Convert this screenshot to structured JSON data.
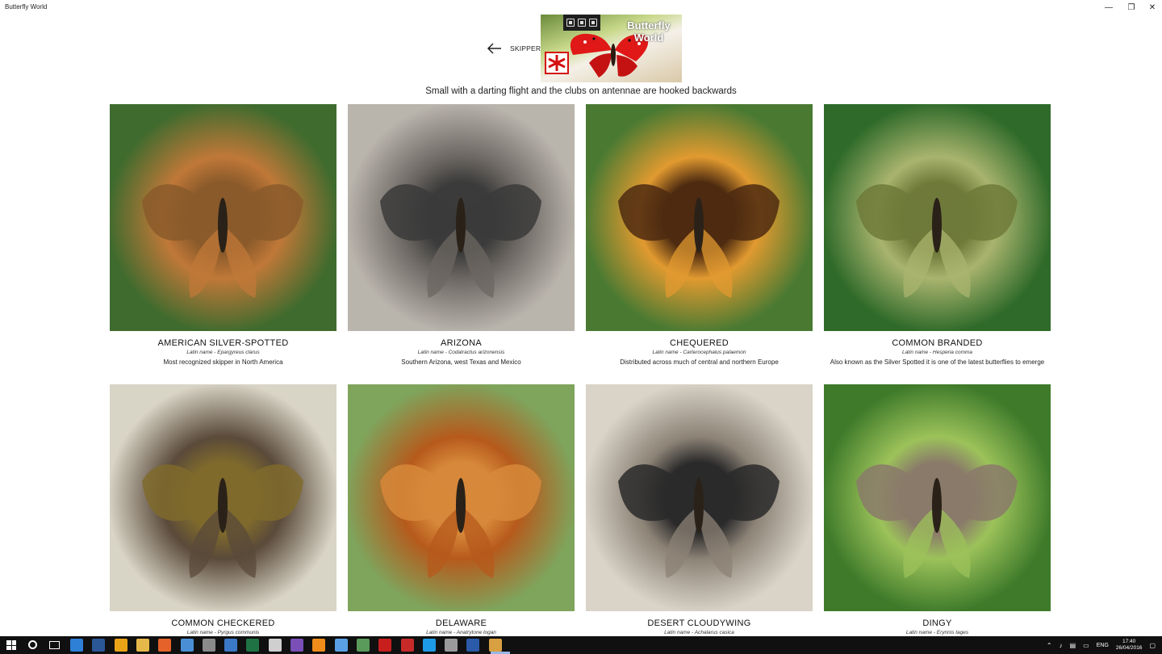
{
  "window": {
    "title": "Butterfly World",
    "minimize_glyph": "—",
    "restore_glyph": "❐",
    "close_glyph": "✕"
  },
  "header": {
    "back_icon": "arrow-left-icon",
    "section": "SKIPPERS",
    "logo_title_line1": "Butterfly",
    "logo_title_line2": "World",
    "subtitle": "Small with a darting flight and the clubs on antennae are hooked backwards"
  },
  "butterflies": [
    {
      "name": "AMERICAN SILVER-SPOTTED",
      "latin": "Latin name - Epargyreus clarus",
      "desc": "Most recognized skipper in North America",
      "colors": [
        "#8a5a2a",
        "#3f6b2e",
        "#c07838"
      ]
    },
    {
      "name": "ARIZONA",
      "latin": "Latin name - Codatractus arizonensis",
      "desc": "Southern Arizona, west Texas and Mexico",
      "colors": [
        "#3b3b3b",
        "#b9b4ac",
        "#6c6762"
      ]
    },
    {
      "name": "CHEQUERED",
      "latin": "Latin name - Carterocephalus palaemon",
      "desc": "Distributed across much of central and northern Europe",
      "colors": [
        "#4d2a10",
        "#4a7a32",
        "#e19a30"
      ]
    },
    {
      "name": "COMMON BRANDED",
      "latin": "Latin name - Hesperia comma",
      "desc": "Also known as the Silver Spotted it is one of the latest butterflies to emerge",
      "colors": [
        "#6f7a3a",
        "#2f6a2a",
        "#a9b46e"
      ]
    },
    {
      "name": "COMMON CHECKERED",
      "latin": "Latin name - Pyrgus communis",
      "desc": "",
      "colors": [
        "#7f6a2c",
        "#d8d4c6",
        "#5a4a3a"
      ]
    },
    {
      "name": "DELAWARE",
      "latin": "Latin name - Anatrytone logan",
      "desc": "",
      "colors": [
        "#d7883a",
        "#7fa45c",
        "#b65a1c"
      ]
    },
    {
      "name": "DESERT CLOUDYWING",
      "latin": "Latin name - Achalarus casica",
      "desc": "",
      "colors": [
        "#2a2a2a",
        "#d9d3c8",
        "#8c8276"
      ]
    },
    {
      "name": "DINGY",
      "latin": "Latin name - Erynnis tages",
      "desc": "",
      "colors": [
        "#8a7a6a",
        "#3e7a2a",
        "#9cc25a"
      ]
    }
  ],
  "taskbar": {
    "language": "ENG",
    "time": "17:40",
    "date": "26/04/2016",
    "apps": [
      {
        "name": "edge-icon",
        "color": "#2e7fd6"
      },
      {
        "name": "word-icon",
        "color": "#2b5797"
      },
      {
        "name": "chrome-icon",
        "color": "#e8a317"
      },
      {
        "name": "file-explorer-icon",
        "color": "#e6b84a"
      },
      {
        "name": "firefox-icon",
        "color": "#e5622a"
      },
      {
        "name": "photos-icon",
        "color": "#4a8fd6"
      },
      {
        "name": "airplane-app-icon",
        "color": "#8a8a8a"
      },
      {
        "name": "store-icon",
        "color": "#3b78c8"
      },
      {
        "name": "excel-icon",
        "color": "#1f7244"
      },
      {
        "name": "settings-icon",
        "color": "#cfcfcf"
      },
      {
        "name": "visual-studio-icon",
        "color": "#7a4fb8"
      },
      {
        "name": "vlc-icon",
        "color": "#f08c1a"
      },
      {
        "name": "app-icon",
        "color": "#5aa0e6"
      },
      {
        "name": "globe-app-icon",
        "color": "#5a9a5a"
      },
      {
        "name": "acrobat-icon",
        "color": "#c81e1e"
      },
      {
        "name": "library-icon",
        "color": "#c82a2a"
      },
      {
        "name": "skype-icon",
        "color": "#1e9be6"
      },
      {
        "name": "plane-icon",
        "color": "#9a9a9a"
      },
      {
        "name": "pdf-app-icon",
        "color": "#2a5aa8"
      },
      {
        "name": "butterfly-world-icon",
        "color": "#d8a040"
      }
    ]
  }
}
